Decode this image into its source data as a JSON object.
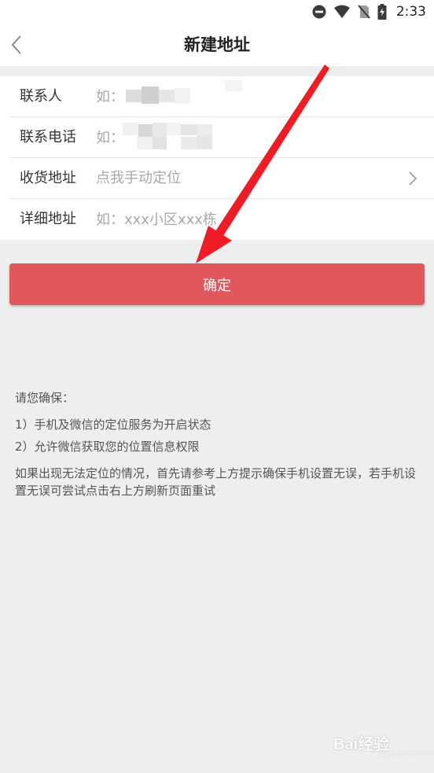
{
  "status_bar": {
    "time": "2:33",
    "icons": [
      "do-not-disturb-icon",
      "wifi-icon",
      "no-sim-icon",
      "battery-charging-icon"
    ]
  },
  "header": {
    "title": "新建地址",
    "back_icon": "chevron-left-icon"
  },
  "form": {
    "contact": {
      "label": "联系人",
      "placeholder": "如："
    },
    "phone": {
      "label": "联系电话",
      "placeholder": "如："
    },
    "location": {
      "label": "收货地址",
      "placeholder": "点我手动定位",
      "icon": "chevron-right-icon"
    },
    "detail": {
      "label": "详细地址",
      "placeholder": "如：xxx小区xxx栋"
    }
  },
  "confirm_button": {
    "label": "确定"
  },
  "tips": {
    "heading": "请您确保：",
    "items": [
      "1）手机及微信的定位服务为开启状态",
      "2）允许微信获取您的位置信息权限"
    ],
    "note": "如果出现无法定位的情况，首先请参考上方提示确保手机设置无误，若手机设置无误可尝试点击右上方刷新页面重试"
  },
  "watermark": {
    "text": "Bai经验",
    "sub": "jingyan.baidu.com"
  },
  "colors": {
    "accent": "#e0585b",
    "annotation_arrow": "#ee1c25",
    "background": "#eeeeee"
  }
}
